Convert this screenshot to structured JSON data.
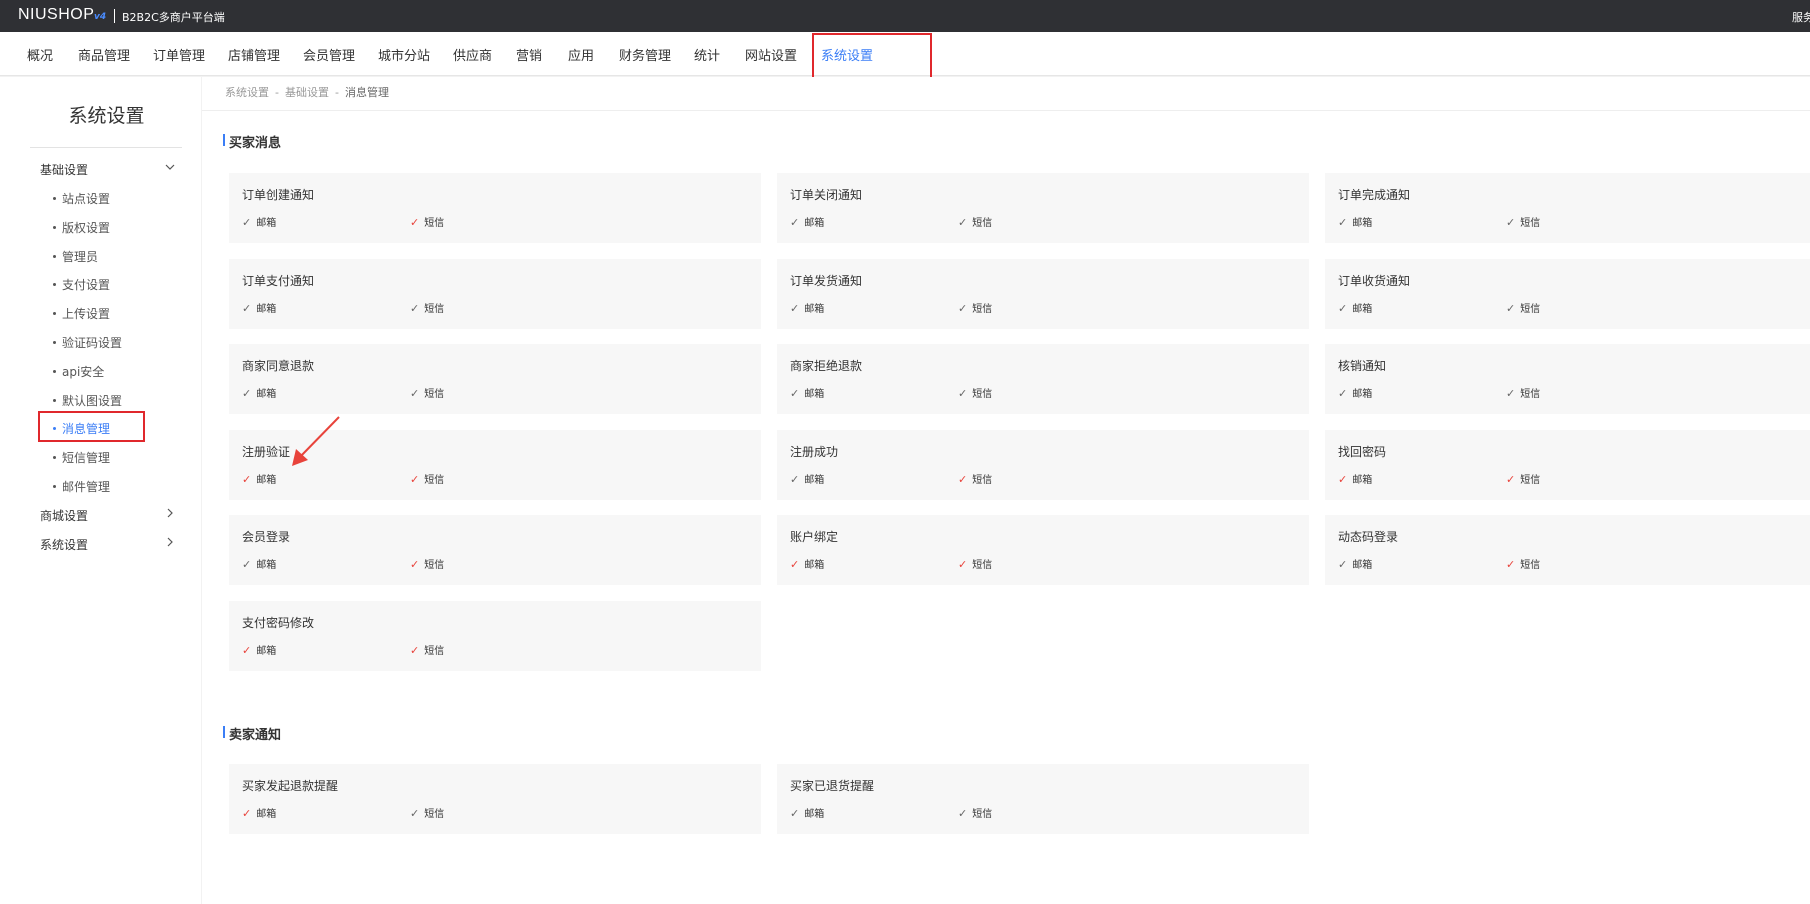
{
  "topbar": {
    "logo": "NIUSHOP",
    "logo_version": "v4",
    "subtitle": "B2B2C多商户平台端",
    "right_text": "服务"
  },
  "nav": {
    "items": [
      "概况",
      "商品管理",
      "订单管理",
      "店铺管理",
      "会员管理",
      "城市分站",
      "供应商",
      "营销",
      "应用",
      "财务管理",
      "统计",
      "网站设置",
      "系统设置"
    ],
    "active_index": 12
  },
  "sidebar": {
    "title": "系统设置",
    "group_basic": "基础设置",
    "basic_items": [
      "站点设置",
      "版权设置",
      "管理员",
      "支付设置",
      "上传设置",
      "验证码设置",
      "api安全",
      "默认图设置",
      "消息管理",
      "短信管理",
      "邮件管理"
    ],
    "active_item": "消息管理",
    "group_mall": "商城设置",
    "group_system": "系统设置"
  },
  "breadcrumb": {
    "items": [
      "系统设置",
      "基础设置",
      "消息管理"
    ],
    "separator": "-"
  },
  "buyer_section": {
    "title": "买家消息",
    "cards": [
      {
        "title": "订单创建通知",
        "email_label": "邮箱",
        "sms_label": "短信",
        "email_check": "gray",
        "sms_check": "red"
      },
      {
        "title": "订单关闭通知",
        "email_label": "邮箱",
        "sms_label": "短信",
        "email_check": "gray",
        "sms_check": "gray"
      },
      {
        "title": "订单完成通知",
        "email_label": "邮箱",
        "sms_label": "短信",
        "email_check": "gray",
        "sms_check": "gray"
      },
      {
        "title": "订单支付通知",
        "email_label": "邮箱",
        "sms_label": "短信",
        "email_check": "gray",
        "sms_check": "gray"
      },
      {
        "title": "订单发货通知",
        "email_label": "邮箱",
        "sms_label": "短信",
        "email_check": "gray",
        "sms_check": "gray"
      },
      {
        "title": "订单收货通知",
        "email_label": "邮箱",
        "sms_label": "短信",
        "email_check": "gray",
        "sms_check": "gray"
      },
      {
        "title": "商家同意退款",
        "email_label": "邮箱",
        "sms_label": "短信",
        "email_check": "gray",
        "sms_check": "gray"
      },
      {
        "title": "商家拒绝退款",
        "email_label": "邮箱",
        "sms_label": "短信",
        "email_check": "gray",
        "sms_check": "gray"
      },
      {
        "title": "核销通知",
        "email_label": "邮箱",
        "sms_label": "短信",
        "email_check": "gray",
        "sms_check": "gray"
      },
      {
        "title": "注册验证",
        "email_label": "邮箱",
        "sms_label": "短信",
        "email_check": "red",
        "sms_check": "red"
      },
      {
        "title": "注册成功",
        "email_label": "邮箱",
        "sms_label": "短信",
        "email_check": "gray",
        "sms_check": "red"
      },
      {
        "title": "找回密码",
        "email_label": "邮箱",
        "sms_label": "短信",
        "email_check": "red",
        "sms_check": "red"
      },
      {
        "title": "会员登录",
        "email_label": "邮箱",
        "sms_label": "短信",
        "email_check": "gray",
        "sms_check": "red"
      },
      {
        "title": "账户绑定",
        "email_label": "邮箱",
        "sms_label": "短信",
        "email_check": "red",
        "sms_check": "red"
      },
      {
        "title": "动态码登录",
        "email_label": "邮箱",
        "sms_label": "短信",
        "email_check": "gray",
        "sms_check": "red"
      },
      {
        "title": "支付密码修改",
        "email_label": "邮箱",
        "sms_label": "短信",
        "email_check": "red",
        "sms_check": "red"
      }
    ]
  },
  "seller_section": {
    "title": "卖家通知",
    "cards": [
      {
        "title": "买家发起退款提醒",
        "email_label": "邮箱",
        "sms_label": "短信",
        "email_check": "red",
        "sms_check": "gray"
      },
      {
        "title": "买家已退货提醒",
        "email_label": "邮箱",
        "sms_label": "短信",
        "email_check": "gray",
        "sms_check": "gray"
      }
    ]
  },
  "colors": {
    "accent": "#3b7ef6",
    "highlight": "#e0282c",
    "check_red": "#e8433b",
    "topbar": "#2f3034"
  },
  "icons": {
    "check": "check-icon",
    "chevron_down": "chevron-down-icon",
    "chevron_right": "chevron-right-icon",
    "annotation": "red-arrow-icon"
  }
}
